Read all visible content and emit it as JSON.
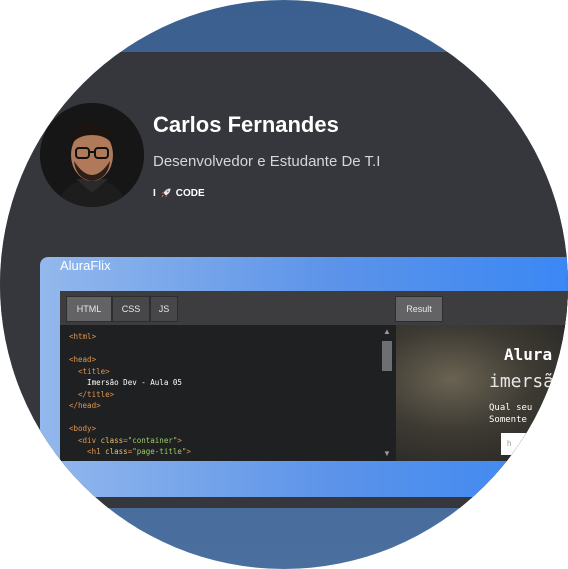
{
  "profile": {
    "name": "Carlos Fernandes",
    "role": "Desenvolvedor e Estudante De T.I",
    "tag_prefix": "I",
    "tag_icon": "rocket-icon",
    "tag_text": "CODE"
  },
  "project": {
    "title": "AluraFlix",
    "tabs": [
      "HTML",
      "CSS",
      "JS"
    ],
    "result_tab": "Result",
    "code_lines": [
      "<html>",
      "",
      "<head>",
      "  <title>",
      "    Imersão Dev - Aula 05",
      "  </title>",
      "</head>",
      "",
      "<body>",
      "  <div class=\"container\">",
      "    <h1 class=\"page-title\">"
    ],
    "result": {
      "heading": "Alura",
      "subheading": "imersã",
      "line1": "Qual seu",
      "line2": "Somente",
      "input_text": "h"
    }
  },
  "colors": {
    "card_bg": "#35373c",
    "accent": "#3987f5",
    "code_tag": "#e09550"
  }
}
